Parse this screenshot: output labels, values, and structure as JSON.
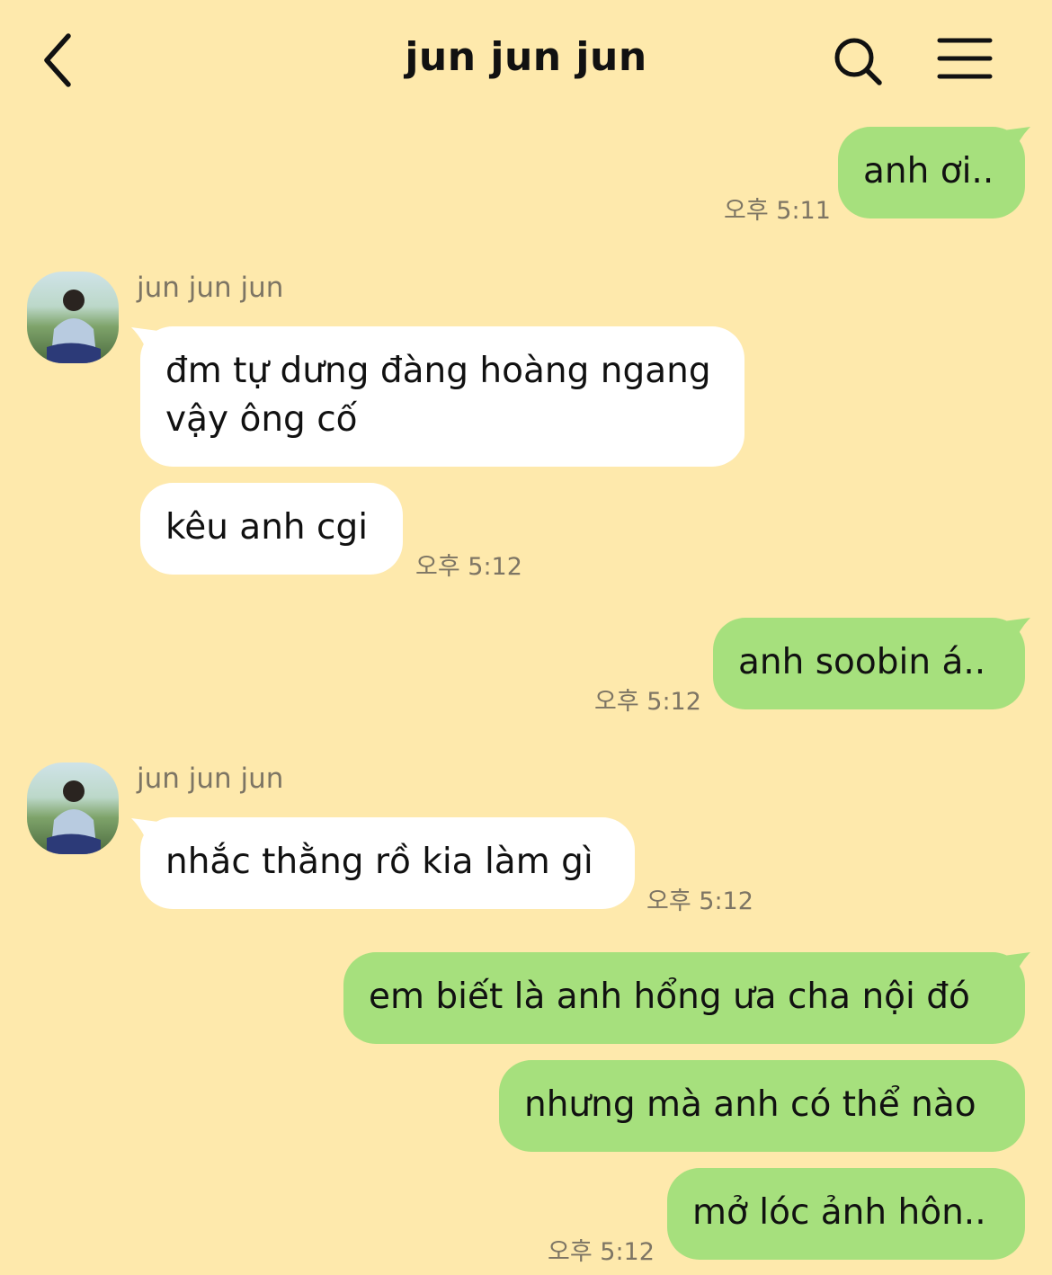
{
  "header": {
    "title": "jun jun jun"
  },
  "colors": {
    "background": "#fee9ac",
    "my_bubble": "#a6e07d",
    "their_bubble": "#ffffff",
    "timestamp": "#7d7564"
  },
  "messages": [
    {
      "from": "me",
      "text": "anh ơi..",
      "time": "오후 5:11"
    },
    {
      "from": "them",
      "sender": "jun jun jun",
      "text": "đm tự dưng đàng hoàng ngang vậy ông cố"
    },
    {
      "from": "them",
      "text": "kêu anh cgi",
      "time": "오후 5:12"
    },
    {
      "from": "me",
      "text": "anh soobin á..",
      "time": "오후 5:12"
    },
    {
      "from": "them",
      "sender": "jun jun jun",
      "text": "nhắc thằng rồ kia làm gì",
      "time": "오후 5:12"
    },
    {
      "from": "me",
      "text": "em biết là anh hổng ưa cha nội đó"
    },
    {
      "from": "me",
      "text": "nhưng mà anh có thể nào"
    },
    {
      "from": "me",
      "text": "mở lóc ảnh hôn..",
      "time": "오후 5:12"
    }
  ]
}
